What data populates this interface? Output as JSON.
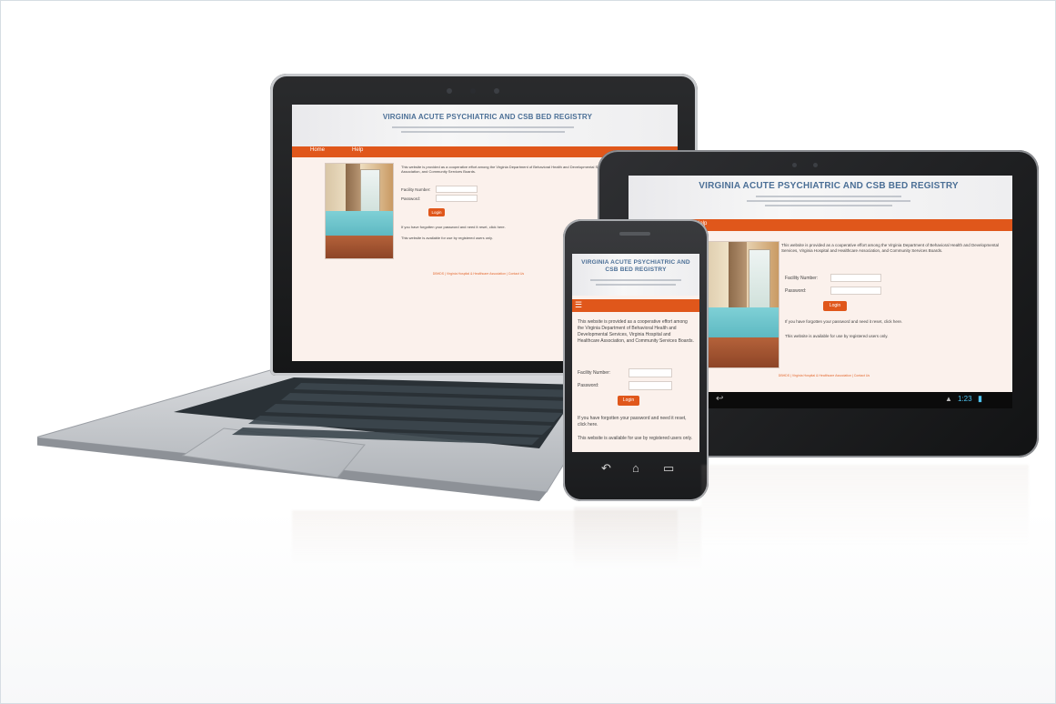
{
  "site": {
    "title": "VIRGINIA ACUTE PSYCHIATRIC AND CSB BED REGISTRY",
    "title_short": "VIRGINIA ACUTE PSYCHIATRIC AND CSB BED REGISTRY",
    "nav": [
      "Home",
      "Help"
    ],
    "intro": "This website is provided as a cooperative effort among the Virginia Department of Behavioral Health and Developmental Services, Virginia Hospital and Healthcare Association, and Community Services Boards.",
    "facility_label": "Facility Number:",
    "password_label": "Password:",
    "login_label": "Login",
    "forgot_text": "If you have forgotten your password and need it reset, click here.",
    "availability_text": "This website is available for use by registered users only.",
    "footer_text": "DBHDS | Virginia Hospital & Healthcare Association | Contact Us"
  },
  "tablet_statusbar": {
    "time": "1:23"
  },
  "colors": {
    "accent": "#e0571b",
    "title_blue": "#4b6f96",
    "page_bg": "#fbf1ec"
  },
  "icons": [
    "back-icon",
    "home-icon",
    "recent-apps-icon",
    "menu-icon",
    "wifi-icon",
    "battery-icon"
  ]
}
